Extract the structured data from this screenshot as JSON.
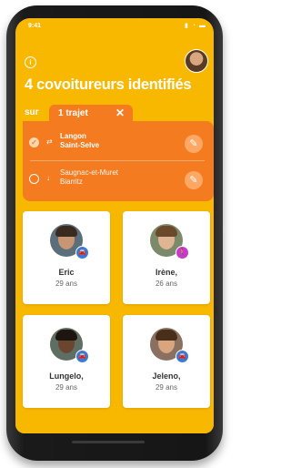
{
  "status_bar": {
    "time": "9:41",
    "icons": "▮ ◔ ▬"
  },
  "header": {
    "title": "4 covoitureurs identifiés"
  },
  "tabs": {
    "previous": "sur",
    "active": "1 trajet",
    "close": "✕"
  },
  "trip": {
    "rows": [
      {
        "from": "Langon",
        "to": "Saint-Selve",
        "checked": true
      },
      {
        "from": "Saugnac-et-Muret",
        "to": "Biarritz",
        "checked": false
      }
    ]
  },
  "carpoolers": [
    {
      "name": "Eric",
      "age": "29 ans",
      "badge_icon": "car-icon",
      "badge_color": "#3b7bd6"
    },
    {
      "name": "Irène,",
      "age": "26 ans",
      "badge_icon": "walk-icon",
      "badge_color": "#c83bc8"
    },
    {
      "name": "Lungelo,",
      "age": "29 ans",
      "badge_icon": "car-icon",
      "badge_color": "#3b7bd6"
    },
    {
      "name": "Jeleno,",
      "age": "29 ans",
      "badge_icon": "car-icon",
      "badge_color": "#3b7bd6"
    }
  ],
  "colors": {
    "brand_yellow": "#f9b800",
    "accent_orange": "#f47b1f"
  }
}
